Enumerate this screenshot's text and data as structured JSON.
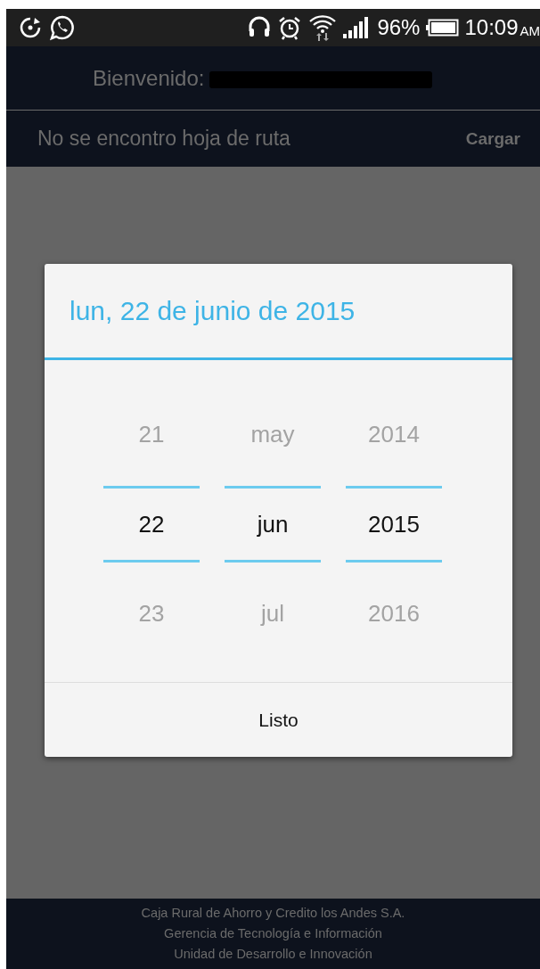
{
  "status_bar": {
    "battery": "96%",
    "time": "10:09",
    "time_suffix": "AM"
  },
  "header": {
    "welcome_label": "Bienvenido:"
  },
  "route_bar": {
    "message": "No se encontro hoja de ruta",
    "action": "Cargar"
  },
  "dialog": {
    "title": "lun, 22 de junio de 2015",
    "columns": [
      {
        "items": [
          {
            "label": "21",
            "selected": false
          },
          {
            "label": "22",
            "selected": true
          },
          {
            "label": "23",
            "selected": false
          }
        ]
      },
      {
        "items": [
          {
            "label": "may",
            "selected": false
          },
          {
            "label": "jun",
            "selected": true
          },
          {
            "label": "jul",
            "selected": false
          }
        ]
      },
      {
        "items": [
          {
            "label": "2014",
            "selected": false
          },
          {
            "label": "2015",
            "selected": true
          },
          {
            "label": "2016",
            "selected": false
          }
        ]
      }
    ],
    "done_button": "Listo"
  },
  "footer": {
    "lines": [
      "Caja Rural de Ahorro y Credito los Andes S.A.",
      "Gerencia de Tecnología e Información",
      "Unidad de Desarrollo e Innovación"
    ]
  }
}
